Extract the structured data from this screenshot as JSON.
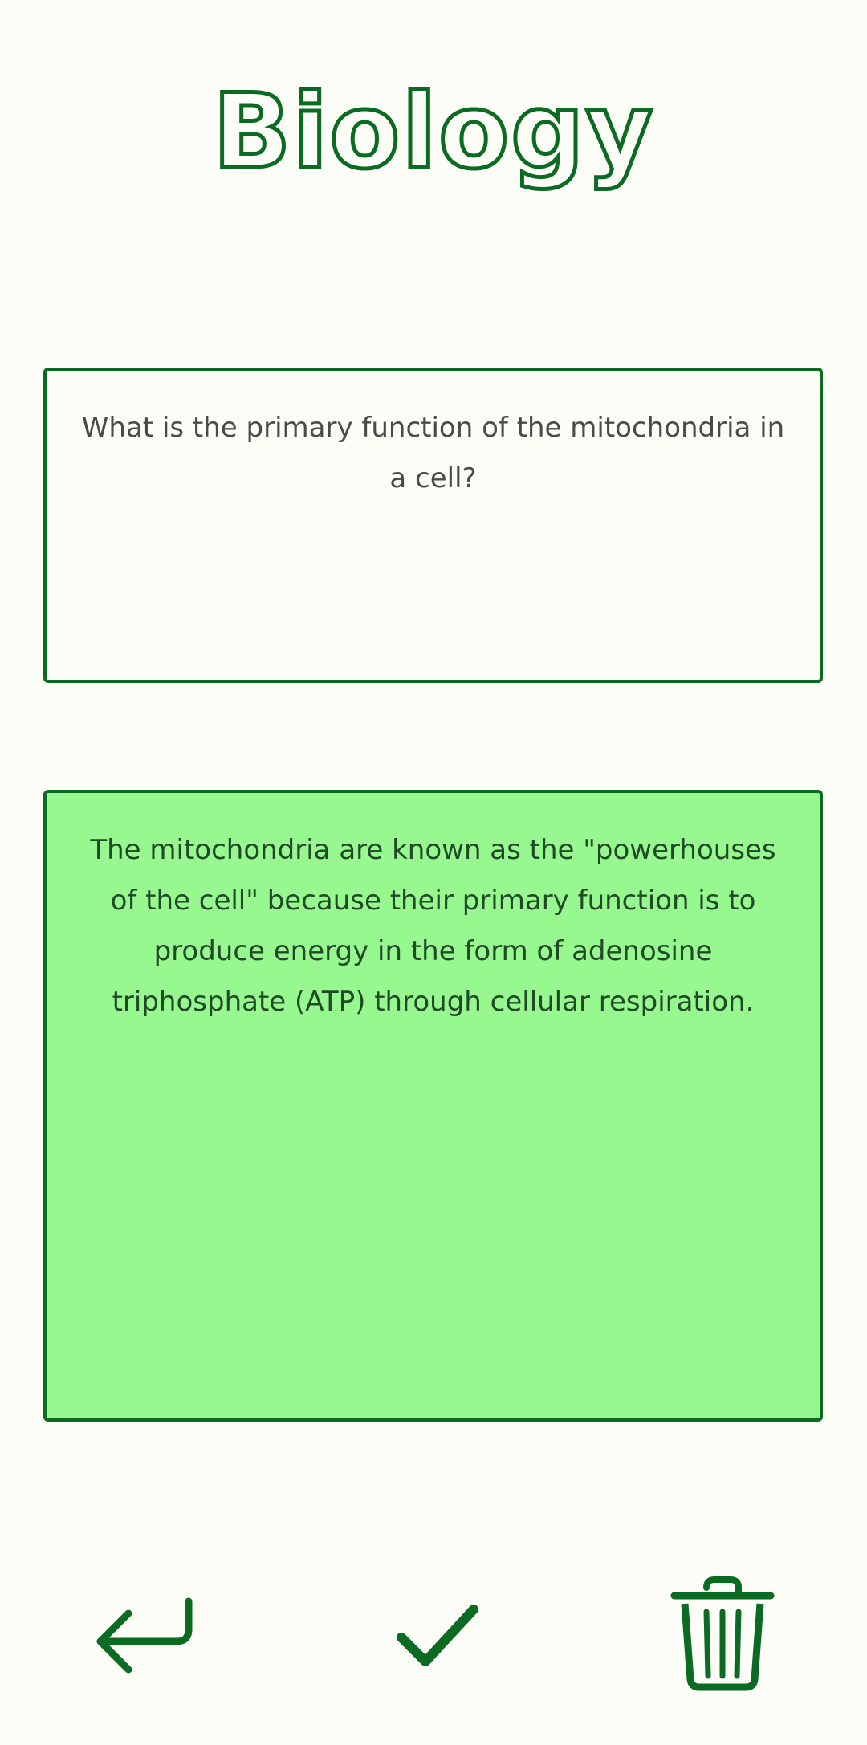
{
  "deck": {
    "title": "Biology"
  },
  "card": {
    "question": "What is the primary function of the mitochondria in a cell?",
    "answer": "The mitochondria are known as the \"powerhouses of the cell\" because their primary function is to produce energy in the form of adenosine triphosphate (ATP) through cellular respiration."
  },
  "colors": {
    "accent": "#0b6b22",
    "background": "#fdfdf8",
    "answer_background": "#98f890"
  },
  "actions": {
    "back_icon": "return-arrow-icon",
    "correct_icon": "check-icon",
    "delete_icon": "trash-icon"
  }
}
